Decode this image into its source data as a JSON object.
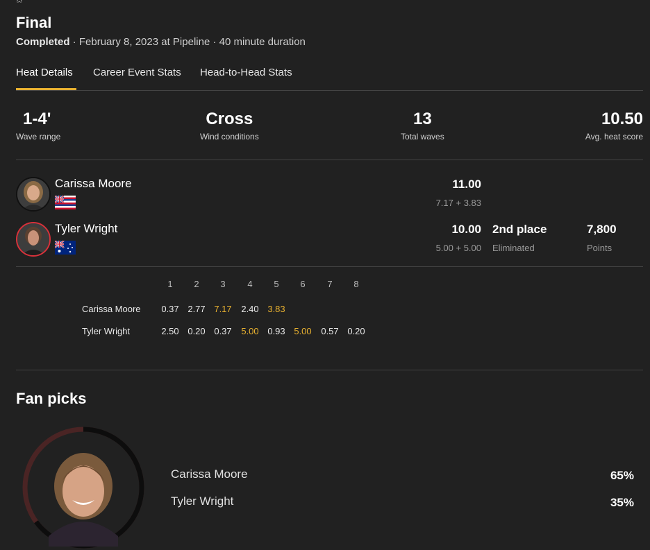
{
  "header": {
    "title": "Final",
    "status": "Completed",
    "details": " · February 8, 2023 at Pipeline · 40 minute duration"
  },
  "tabs": [
    {
      "label": "Heat Details",
      "active": true
    },
    {
      "label": "Career Event Stats",
      "active": false
    },
    {
      "label": "Head-to-Head Stats",
      "active": false
    }
  ],
  "stats": [
    {
      "value": "1-4'",
      "label": "Wave range"
    },
    {
      "value": "Cross",
      "label": "Wind conditions"
    },
    {
      "value": "13",
      "label": "Total waves"
    },
    {
      "value": "10.50",
      "label": "Avg. heat score"
    }
  ],
  "competitors": [
    {
      "name": "Carissa Moore",
      "flag": "hawaii-flag",
      "score": "11.00",
      "breakdown": "7.17 + 3.83",
      "place": "",
      "place_sub": "",
      "points": "",
      "points_sub": ""
    },
    {
      "name": "Tyler Wright",
      "flag": "australia-flag",
      "score": "10.00",
      "breakdown": "5.00 + 5.00",
      "place": "2nd place",
      "place_sub": "Eliminated",
      "points": "7,800",
      "points_sub": "Points"
    }
  ],
  "waves": {
    "headers": [
      "1",
      "2",
      "3",
      "4",
      "5",
      "6",
      "7",
      "8"
    ],
    "rows": [
      {
        "name": "Carissa Moore",
        "scores": [
          "0.37",
          "2.77",
          "7.17",
          "2.40",
          "3.83"
        ],
        "highlight": [
          2,
          4
        ]
      },
      {
        "name": "Tyler Wright",
        "scores": [
          "2.50",
          "0.20",
          "0.37",
          "5.00",
          "0.93",
          "5.00",
          "0.57",
          "0.20"
        ],
        "highlight": [
          3,
          5
        ]
      }
    ]
  },
  "fan_picks": {
    "title": "Fan picks",
    "picks": [
      {
        "name": "Carissa Moore",
        "percent": "65%",
        "share": 0.65
      },
      {
        "name": "Tyler Wright",
        "percent": "35%",
        "share": 0.35
      }
    ]
  },
  "colors": {
    "accent": "#e8b130",
    "background": "#212121",
    "ring_primary": "#0d0d0d",
    "ring_secondary": "#4a2424"
  }
}
